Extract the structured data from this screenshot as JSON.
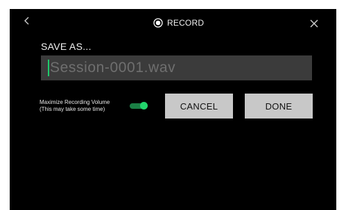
{
  "header": {
    "title": "RECORD",
    "icons": {
      "back": "chevron-left-icon",
      "record": "record-radio-icon",
      "close": "close-icon"
    }
  },
  "save_dialog": {
    "label": "SAVE AS...",
    "filename_value": "Session-0001.wav"
  },
  "options": {
    "maximize_label_line1": "Maximize Recording Volume",
    "maximize_label_line2": "(This may take some time)",
    "maximize_enabled": true
  },
  "buttons": {
    "cancel_label": "CANCEL",
    "done_label": "DONE"
  },
  "colors": {
    "background": "#000000",
    "accent_green": "#22d46c",
    "input_bg": "#3b3b3b",
    "button_bg": "#c8c8c8"
  }
}
